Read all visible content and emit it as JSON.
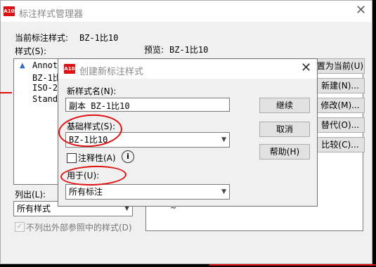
{
  "bg": {
    "title": "标注样式管理器",
    "current_label": "当前标注样式:",
    "current_value": "BZ-1比10",
    "styles_label": "样式(S):",
    "preview_label": "预览:",
    "preview_value": "BZ-1比10",
    "styles": [
      "Annota",
      "BZ-1比",
      "ISO-25",
      "Standa"
    ],
    "list_label": "列出(L):",
    "list_value": "所有样式",
    "checkbox_label": "不列出外部参照中的样式(D)",
    "buttons": [
      "置为当前(U)",
      "新建(N)...",
      "修改(M)...",
      "替代(O)...",
      "比较(C)..."
    ]
  },
  "dlg": {
    "title": "创建新标注样式",
    "new_name_label": "新样式名(N):",
    "new_name_value": "副本 BZ-1比10",
    "base_label": "基础样式(S):",
    "base_value": "BZ-1比10",
    "annotative_label": "注释性(A)",
    "use_for_label": "用于(U):",
    "use_for_value": "所有标注",
    "continue": "继续",
    "cancel": "取消",
    "help": "帮助(H)"
  },
  "icons": {
    "app": "autocad-icon",
    "info": "info-icon",
    "close": "close-icon"
  }
}
